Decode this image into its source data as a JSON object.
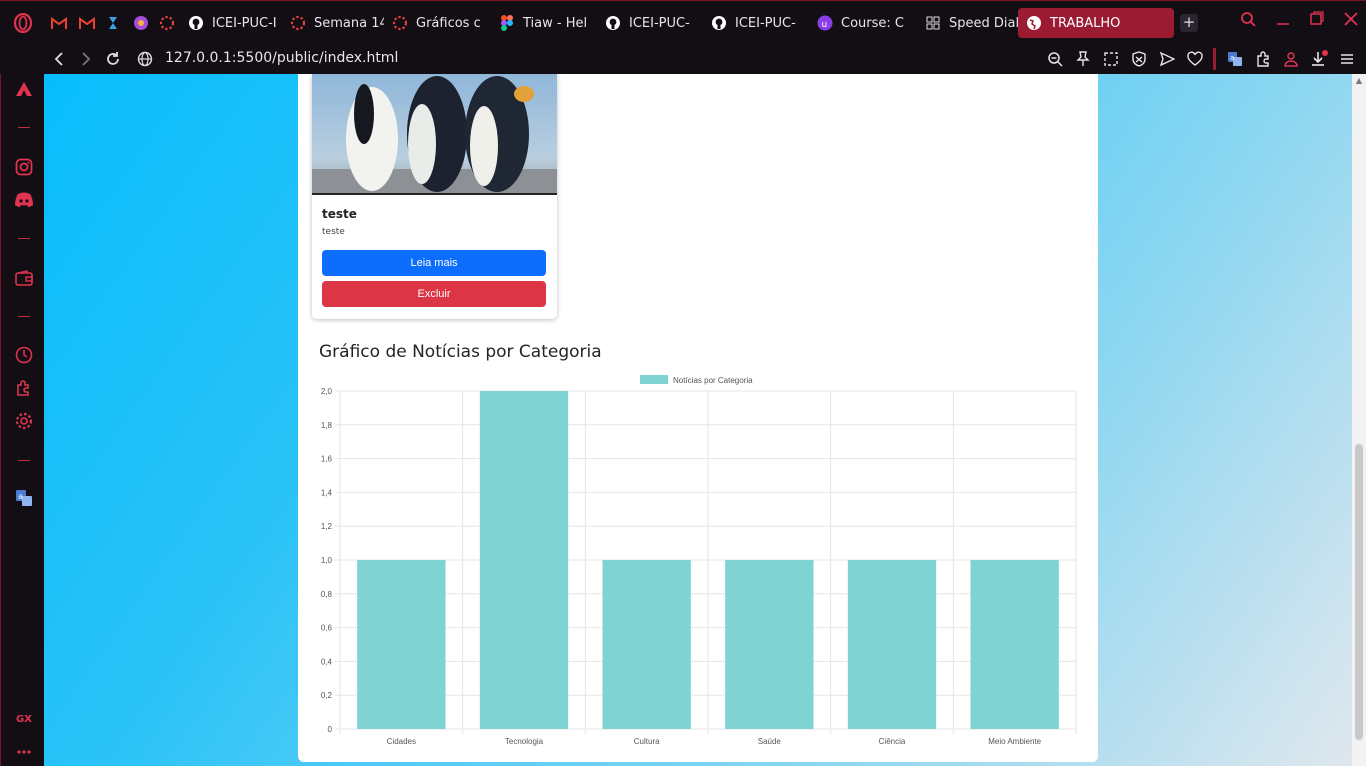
{
  "browser": {
    "tabs": [
      {
        "label": "",
        "icon": "gmail-icon"
      },
      {
        "label": "",
        "icon": "gmail-icon"
      },
      {
        "label": "",
        "icon": "power-automate-icon"
      },
      {
        "label": "",
        "icon": "copilot-icon"
      },
      {
        "label": "",
        "icon": "canvas-icon"
      },
      {
        "label": "ICEI-PUC-I",
        "icon": "github-icon"
      },
      {
        "label": "Semana 14",
        "icon": "canvas-icon"
      },
      {
        "label": "Gráficos c",
        "icon": "canvas-icon"
      },
      {
        "label": "Tiaw - Hel",
        "icon": "figma-icon"
      },
      {
        "label": "ICEI-PUC-",
        "icon": "github-icon"
      },
      {
        "label": "ICEI-PUC-",
        "icon": "github-icon"
      },
      {
        "label": "Course: C",
        "icon": "udemy-icon"
      },
      {
        "label": "Speed Dial",
        "icon": "grid-icon"
      }
    ],
    "active_tab": {
      "label": "TRABALHO",
      "icon": "globe-icon"
    },
    "url": "127.0.0.1:5500/public/index.html",
    "accent": "#e0334f"
  },
  "card": {
    "title": "teste",
    "text": "teste",
    "read_more": "Leia mais",
    "delete": "Excluir"
  },
  "chart_section": {
    "heading": "Gráfico de Notícias por Categoria"
  },
  "chart_data": {
    "type": "bar",
    "categories": [
      "Cidades",
      "Tecnologia",
      "Cultura",
      "Saúde",
      "Ciência",
      "Meio Ambiente"
    ],
    "series": [
      {
        "name": "Notícias por Categoria",
        "values": [
          1,
          2,
          1,
          1,
          1,
          1
        ],
        "color": "#7fd3d3"
      }
    ],
    "ylim": [
      0,
      2
    ],
    "yticks": [
      "0",
      "0,2",
      "0,4",
      "0,6",
      "0,8",
      "1,0",
      "1,2",
      "1,4",
      "1,6",
      "1,8",
      "2,0"
    ],
    "grid": true,
    "legend": "top"
  },
  "sidebar": {
    "bottom_label": "GX"
  }
}
